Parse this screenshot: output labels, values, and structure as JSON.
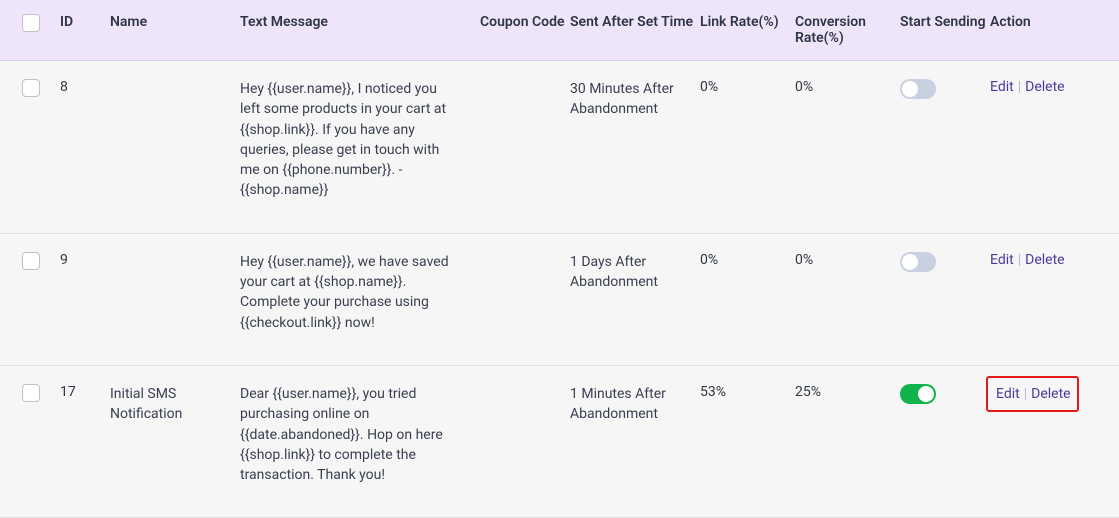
{
  "headers": {
    "id": "ID",
    "name": "Name",
    "text_message": "Text Message",
    "coupon_code": "Coupon Code",
    "sent_after": "Sent After Set Time",
    "link_rate": "Link Rate(%)",
    "conversion_rate": "Conversion Rate(%)",
    "start_sending": "Start Sending",
    "action": "Action"
  },
  "rows": [
    {
      "id": "8",
      "name": "",
      "text_message": "Hey {{user.name}}, I noticed you left some products in your cart at {{shop.link}}. If you have any queries, please get in touch with me on {{phone.number}}. -{{shop.name}}",
      "coupon_code": "",
      "sent_after": "30 Minutes After Abandonment",
      "link_rate": "0%",
      "conversion_rate": "0%",
      "start_sending": false,
      "highlight_action": false
    },
    {
      "id": "9",
      "name": "",
      "text_message": "Hey {{user.name}}, we have saved your cart at {{shop.name}}. Complete your purchase using {{checkout.link}} now!",
      "coupon_code": "",
      "sent_after": "1 Days After Abandonment",
      "link_rate": "0%",
      "conversion_rate": "0%",
      "start_sending": false,
      "highlight_action": false
    },
    {
      "id": "17",
      "name": "Initial SMS Notification",
      "text_message": "Dear {{user.name}}, you tried purchasing online on {{date.abandoned}}. Hop on here {{shop.link}} to complete the transaction. Thank you!",
      "coupon_code": "",
      "sent_after": "1 Minutes After Abandonment",
      "link_rate": "53%",
      "conversion_rate": "25%",
      "start_sending": true,
      "highlight_action": true
    }
  ],
  "action_labels": {
    "edit": "Edit",
    "delete": "Delete"
  }
}
